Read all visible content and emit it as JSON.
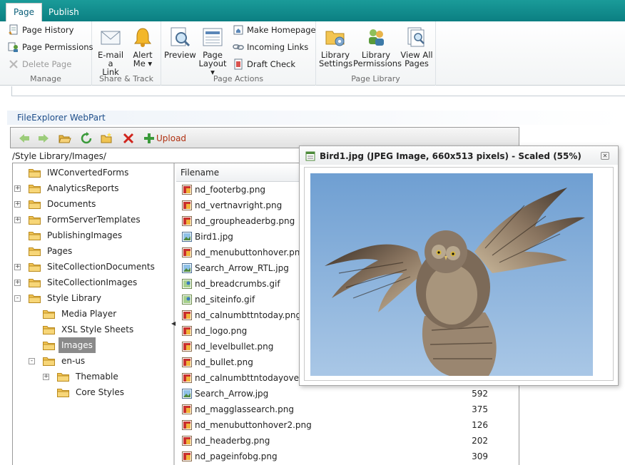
{
  "ribbon": {
    "tabs": [
      {
        "label": "Page",
        "active": true
      },
      {
        "label": "Publish",
        "active": false
      }
    ],
    "manage": {
      "label": "Manage",
      "page_history": "Page History",
      "page_permissions": "Page Permissions",
      "delete_page": "Delete Page"
    },
    "share_track": {
      "label": "Share & Track",
      "email_link_1": "E-mail a",
      "email_link_2": "Link",
      "alert_me_1": "Alert",
      "alert_me_2": "Me ▾"
    },
    "page_actions": {
      "label": "Page Actions",
      "preview": "Preview",
      "page_layout_1": "Page",
      "page_layout_2": "Layout ▾",
      "make_homepage": "Make Homepage",
      "incoming_links": "Incoming Links",
      "draft_check": "Draft Check"
    },
    "page_library": {
      "label": "Page Library",
      "library_settings_1": "Library",
      "library_settings_2": "Settings",
      "library_permissions_1": "Library",
      "library_permissions_2": "Permissions",
      "view_all_pages_1": "View All",
      "view_all_pages_2": "Pages"
    }
  },
  "webpart": {
    "title": "FileExplorer WebPart",
    "toolbar": {
      "icons": [
        "back-arrow-icon",
        "forward-arrow-icon",
        "open-folder-icon",
        "refresh-icon",
        "new-folder-icon",
        "delete-x-icon",
        "upload-plus-icon"
      ],
      "upload_label": "Upload"
    },
    "path": "/Style Library/Images/",
    "tree": [
      {
        "label": "IWConvertedForms",
        "depth": 0,
        "expander": ""
      },
      {
        "label": "AnalyticsReports",
        "depth": 0,
        "expander": "+"
      },
      {
        "label": "Documents",
        "depth": 0,
        "expander": "+"
      },
      {
        "label": "FormServerTemplates",
        "depth": 0,
        "expander": "+"
      },
      {
        "label": "PublishingImages",
        "depth": 0,
        "expander": ""
      },
      {
        "label": "Pages",
        "depth": 0,
        "expander": ""
      },
      {
        "label": "SiteCollectionDocuments",
        "depth": 0,
        "expander": "+"
      },
      {
        "label": "SiteCollectionImages",
        "depth": 0,
        "expander": "+"
      },
      {
        "label": "Style Library",
        "depth": 0,
        "expander": "-"
      },
      {
        "label": "Media Player",
        "depth": 1,
        "expander": ""
      },
      {
        "label": "XSL Style Sheets",
        "depth": 1,
        "expander": ""
      },
      {
        "label": "Images",
        "depth": 1,
        "expander": "",
        "selected": true
      },
      {
        "label": "en-us",
        "depth": 1,
        "expander": "-"
      },
      {
        "label": "Themable",
        "depth": 2,
        "expander": "+"
      },
      {
        "label": "Core Styles",
        "depth": 2,
        "expander": ""
      }
    ],
    "files": {
      "column_filename": "Filename",
      "rows": [
        {
          "name": "nd_footerbg.png",
          "size": "",
          "type": "png"
        },
        {
          "name": "nd_vertnavright.png",
          "size": "",
          "type": "png"
        },
        {
          "name": "nd_groupheaderbg.png",
          "size": "",
          "type": "png"
        },
        {
          "name": "Bird1.jpg",
          "size": "",
          "type": "jpg"
        },
        {
          "name": "nd_menubuttonhover.png",
          "size": "",
          "type": "png"
        },
        {
          "name": "Search_Arrow_RTL.jpg",
          "size": "",
          "type": "jpg"
        },
        {
          "name": "nd_breadcrumbs.gif",
          "size": "",
          "type": "gif"
        },
        {
          "name": "nd_siteinfo.gif",
          "size": "",
          "type": "gif"
        },
        {
          "name": "nd_calnumbttntoday.png",
          "size": "",
          "type": "png"
        },
        {
          "name": "nd_logo.png",
          "size": "",
          "type": "png"
        },
        {
          "name": "nd_levelbullet.png",
          "size": "",
          "type": "png"
        },
        {
          "name": "nd_bullet.png",
          "size": "",
          "type": "png"
        },
        {
          "name": "nd_calnumbttntodayover.png",
          "size": "",
          "type": "png"
        },
        {
          "name": "Search_Arrow.jpg",
          "size": "592",
          "type": "jpg"
        },
        {
          "name": "nd_magglassearch.png",
          "size": "375",
          "type": "png"
        },
        {
          "name": "nd_menubuttonhover2.png",
          "size": "126",
          "type": "png"
        },
        {
          "name": "nd_headerbg.png",
          "size": "202",
          "type": "png"
        },
        {
          "name": "nd_pageinfobg.png",
          "size": "309",
          "type": "png"
        }
      ]
    }
  },
  "preview": {
    "title": "Bird1.jpg (JPEG Image, 660x513 pixels) - Scaled (55%)",
    "close_symbol": "✕",
    "image_subject": "owl in flight"
  },
  "colors": {
    "tabbar": "#0b8a8c",
    "tree_selected": "#8a8a8a",
    "upload_text": "#b03010",
    "webpart_title": "#1e4e8a"
  }
}
